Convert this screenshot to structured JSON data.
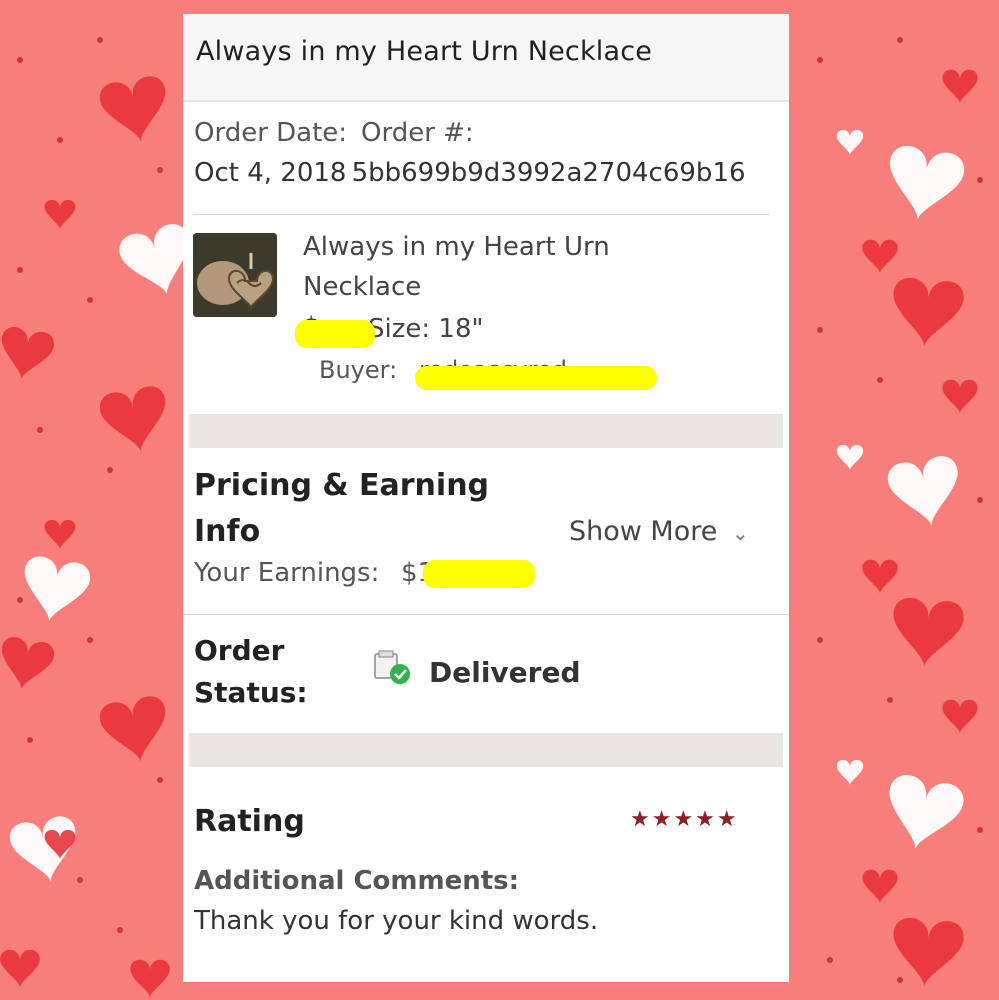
{
  "page": {
    "title": "Always in my Heart Urn Necklace"
  },
  "order": {
    "date_label": "Order Date:",
    "number_label": "Order #:",
    "date_value": "Oct 4, 2018",
    "number_value": "5bb699b9d3992a2704c69b16"
  },
  "item": {
    "name_line1": "Always in my Heart Urn",
    "name_line2": "Necklace",
    "price_visible": "$",
    "size": "Size: 18\"",
    "buyer_label": "Buyer:",
    "buyer_visible": "redoascyred"
  },
  "pricing": {
    "heading_line1": "Pricing & Earning",
    "heading_line2": "Info",
    "show_more": "Show More",
    "earnings_label": "Your Earnings:",
    "earnings_visible": "$1"
  },
  "status": {
    "label_line1": "Order",
    "label_line2": "Status:",
    "value": "Delivered"
  },
  "rating": {
    "heading": "Rating",
    "stars": "★★★★★",
    "comments_label": "Additional Comments:",
    "comment": "Thank you for your kind words."
  },
  "colors": {
    "background": "#f77e7b",
    "star": "#8b1f2a",
    "delivered_check": "#2fb24a",
    "redaction": "#ffff00"
  }
}
